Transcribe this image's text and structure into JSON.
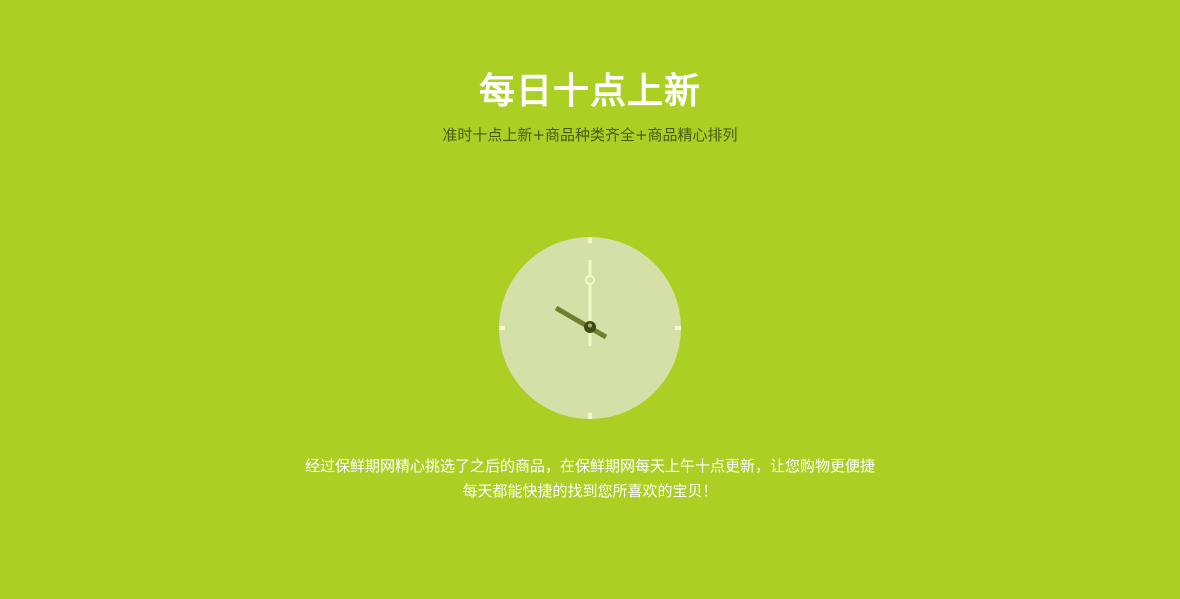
{
  "header": {
    "title": "每日十点上新",
    "subtitle": "准时十点上新+商品种类齐全+商品精心排列"
  },
  "clock": {
    "icon": "clock-icon",
    "time": "10:00",
    "face_color": "#d5e0a8",
    "hand_color": "#f2f9c4",
    "hour_hand_color": "#6f7f2c"
  },
  "description": {
    "line1": "经过保鲜期网精心挑选了之后的商品，在保鲜期网每天上午十点更新，让您购物更便捷",
    "line2": "每天都能快捷的找到您所喜欢的宝贝！"
  },
  "colors": {
    "background": "#abcf22",
    "title": "#ffffff",
    "subtitle": "#4a5a12"
  }
}
